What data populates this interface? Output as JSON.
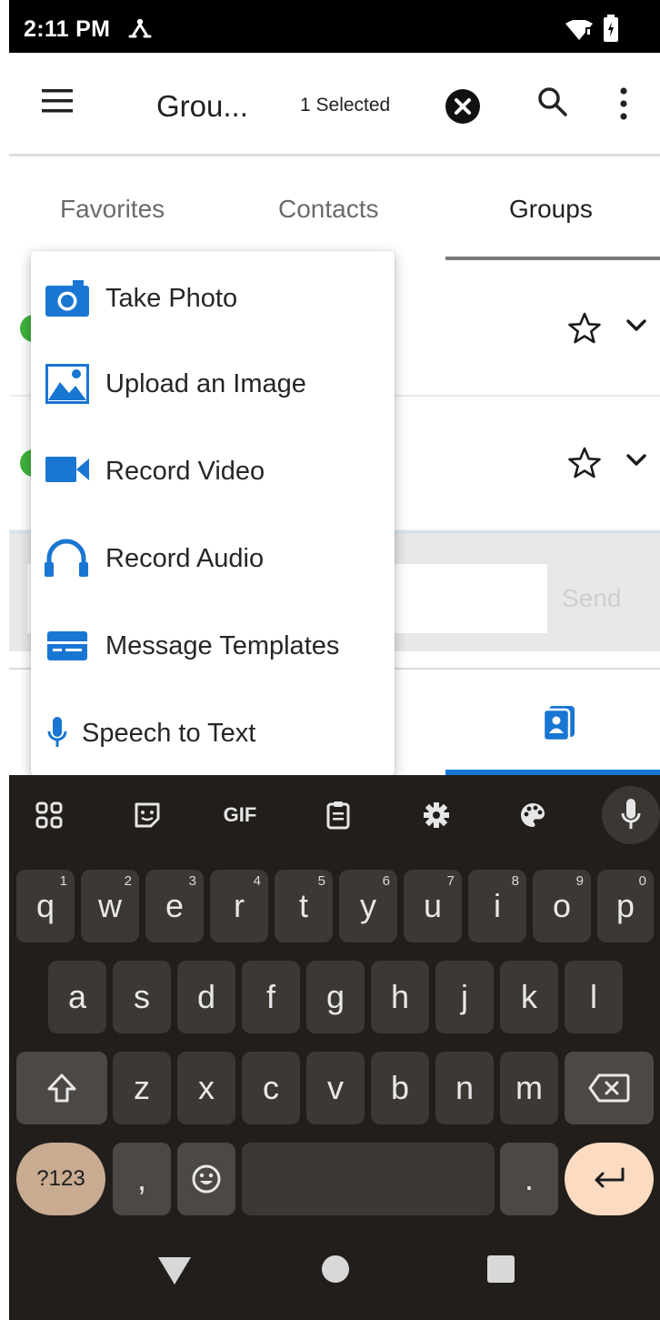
{
  "status_bar": {
    "time": "2:11 PM"
  },
  "app_bar": {
    "title": "Grou...",
    "selected_label": "1 Selected"
  },
  "tabs": [
    {
      "label": "Favorites",
      "active": false
    },
    {
      "label": "Contacts",
      "active": false
    },
    {
      "label": "Groups",
      "active": true
    }
  ],
  "compose": {
    "send_label": "Send"
  },
  "popup_menu": {
    "items": [
      {
        "label": "Take Photo",
        "icon": "camera-icon"
      },
      {
        "label": "Upload an Image",
        "icon": "image-icon"
      },
      {
        "label": "Record Video",
        "icon": "videocam-icon"
      },
      {
        "label": "Record Audio",
        "icon": "headphones-icon"
      },
      {
        "label": "Message Templates",
        "icon": "template-icon"
      },
      {
        "label": "Speech to Text",
        "icon": "mic-icon"
      }
    ]
  },
  "keyboard": {
    "toolbar": {
      "gif_label": "GIF"
    },
    "rows": [
      [
        {
          "k": "q",
          "h": "1"
        },
        {
          "k": "w",
          "h": "2"
        },
        {
          "k": "e",
          "h": "3"
        },
        {
          "k": "r",
          "h": "4"
        },
        {
          "k": "t",
          "h": "5"
        },
        {
          "k": "y",
          "h": "6"
        },
        {
          "k": "u",
          "h": "7"
        },
        {
          "k": "i",
          "h": "8"
        },
        {
          "k": "o",
          "h": "9"
        },
        {
          "k": "p",
          "h": "0"
        }
      ],
      [
        {
          "k": "a"
        },
        {
          "k": "s"
        },
        {
          "k": "d"
        },
        {
          "k": "f"
        },
        {
          "k": "g"
        },
        {
          "k": "h"
        },
        {
          "k": "j"
        },
        {
          "k": "k"
        },
        {
          "k": "l"
        }
      ],
      [
        {
          "k": "z"
        },
        {
          "k": "x"
        },
        {
          "k": "c"
        },
        {
          "k": "v"
        },
        {
          "k": "b"
        },
        {
          "k": "n"
        },
        {
          "k": "m"
        }
      ]
    ],
    "symbols_label": "?123",
    "comma_label": ",",
    "period_label": "."
  },
  "colors": {
    "accent_blue": "#1976d2",
    "keyboard_bg": "#211e1b",
    "key_bg": "#3c3834",
    "symbols_key": "#c8ab91",
    "enter_key": "#fbdcc2",
    "online_green": "#3fb33b"
  }
}
